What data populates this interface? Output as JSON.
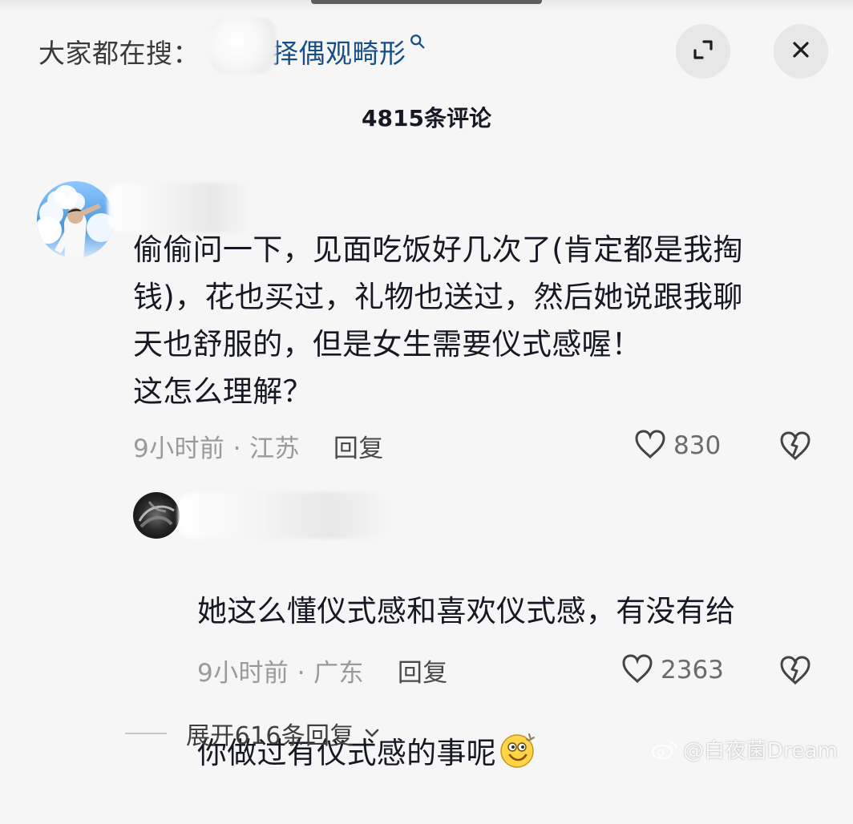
{
  "header": {
    "search_prefix": "大家都在搜：",
    "search_term": "择偶观畸形",
    "comment_count": "4815条评论"
  },
  "comments": [
    {
      "text": "偷偷问一下，见面吃饭好几次了(肯定都是我掏\n钱)，花也买过，礼物也送过，然后她说跟我聊\n天也舒服的，但是女生需要仪式感喔！\n这怎么理解？",
      "time_location": "9小时前 · 江苏",
      "reply_label": "回复",
      "like_count": "830"
    }
  ],
  "reply": {
    "line1": "她这么懂仪式感和喜欢仪式感，有没有给",
    "line2": "你做过有仪式感的事呢",
    "time_location": "9小时前 · 广东",
    "reply_label": "回复",
    "like_count": "2363"
  },
  "expand": {
    "label": "展开616条回复"
  },
  "watermark": {
    "text": "@白夜菌Dream"
  },
  "icons": {
    "search": "search-icon",
    "expand": "expand-icon",
    "close": "close-icon",
    "heart": "heart-icon",
    "broken_heart": "broken-heart-icon",
    "chevron": "chevron-down-icon",
    "emoji": "smile-emoji-icon"
  },
  "colors": {
    "background": "#f6f6f6",
    "primary_text": "#161823",
    "secondary_text": "#9a9a9a",
    "search_term": "#164f86",
    "control_background": "#e7e7e7"
  }
}
